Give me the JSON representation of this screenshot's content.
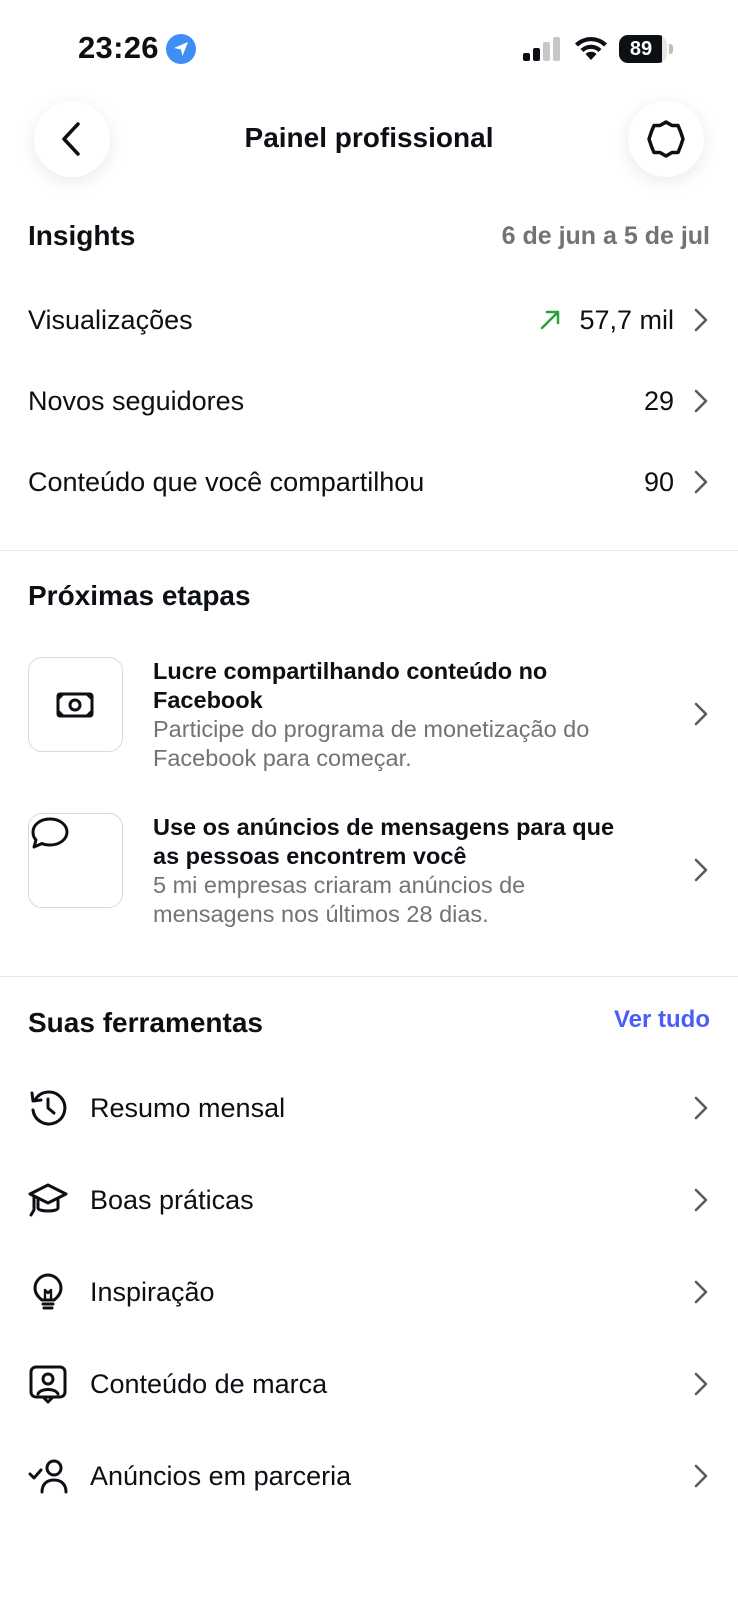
{
  "status_bar": {
    "time": "23:26",
    "battery_level": "89",
    "battery_fraction": 0.89
  },
  "header": {
    "title": "Painel profissional",
    "back_icon": "chevron-left-icon",
    "settings_icon": "gear-icon"
  },
  "insights": {
    "title": "Insights",
    "date_range": "6 de jun a 5 de jul",
    "rows": [
      {
        "label": "Visualizações",
        "value": "57,7 mil",
        "trend": "up",
        "trend_color": "#27a43a"
      },
      {
        "label": "Novos seguidores",
        "value": "29"
      },
      {
        "label": "Conteúdo que você compartilhou",
        "value": "90"
      }
    ]
  },
  "next_steps": {
    "title": "Próximas etapas",
    "cards": [
      {
        "icon": "money-bill-icon",
        "title": "Lucre compartilhando conteúdo no Facebook",
        "subtitle": "Participe do programa de monetização do Facebook para começar."
      },
      {
        "icon": "speech-bubble-icon",
        "title": "Use os anúncios de mensagens para que as pessoas encontrem você",
        "subtitle": "5 mi empresas criaram anúncios de mensagens nos últimos 28 dias."
      }
    ]
  },
  "tools": {
    "title": "Suas ferramentas",
    "see_all": "Ver tudo",
    "see_all_color": "#4a5df9",
    "items": [
      {
        "label": "Resumo mensal",
        "icon": "history-icon"
      },
      {
        "label": "Boas práticas",
        "icon": "graduation-cap-icon"
      },
      {
        "label": "Inspiração",
        "icon": "lightbulb-icon"
      },
      {
        "label": "Conteúdo de marca",
        "icon": "branded-content-icon"
      },
      {
        "label": "Anúncios em parceria",
        "icon": "partnership-ads-icon"
      }
    ]
  }
}
